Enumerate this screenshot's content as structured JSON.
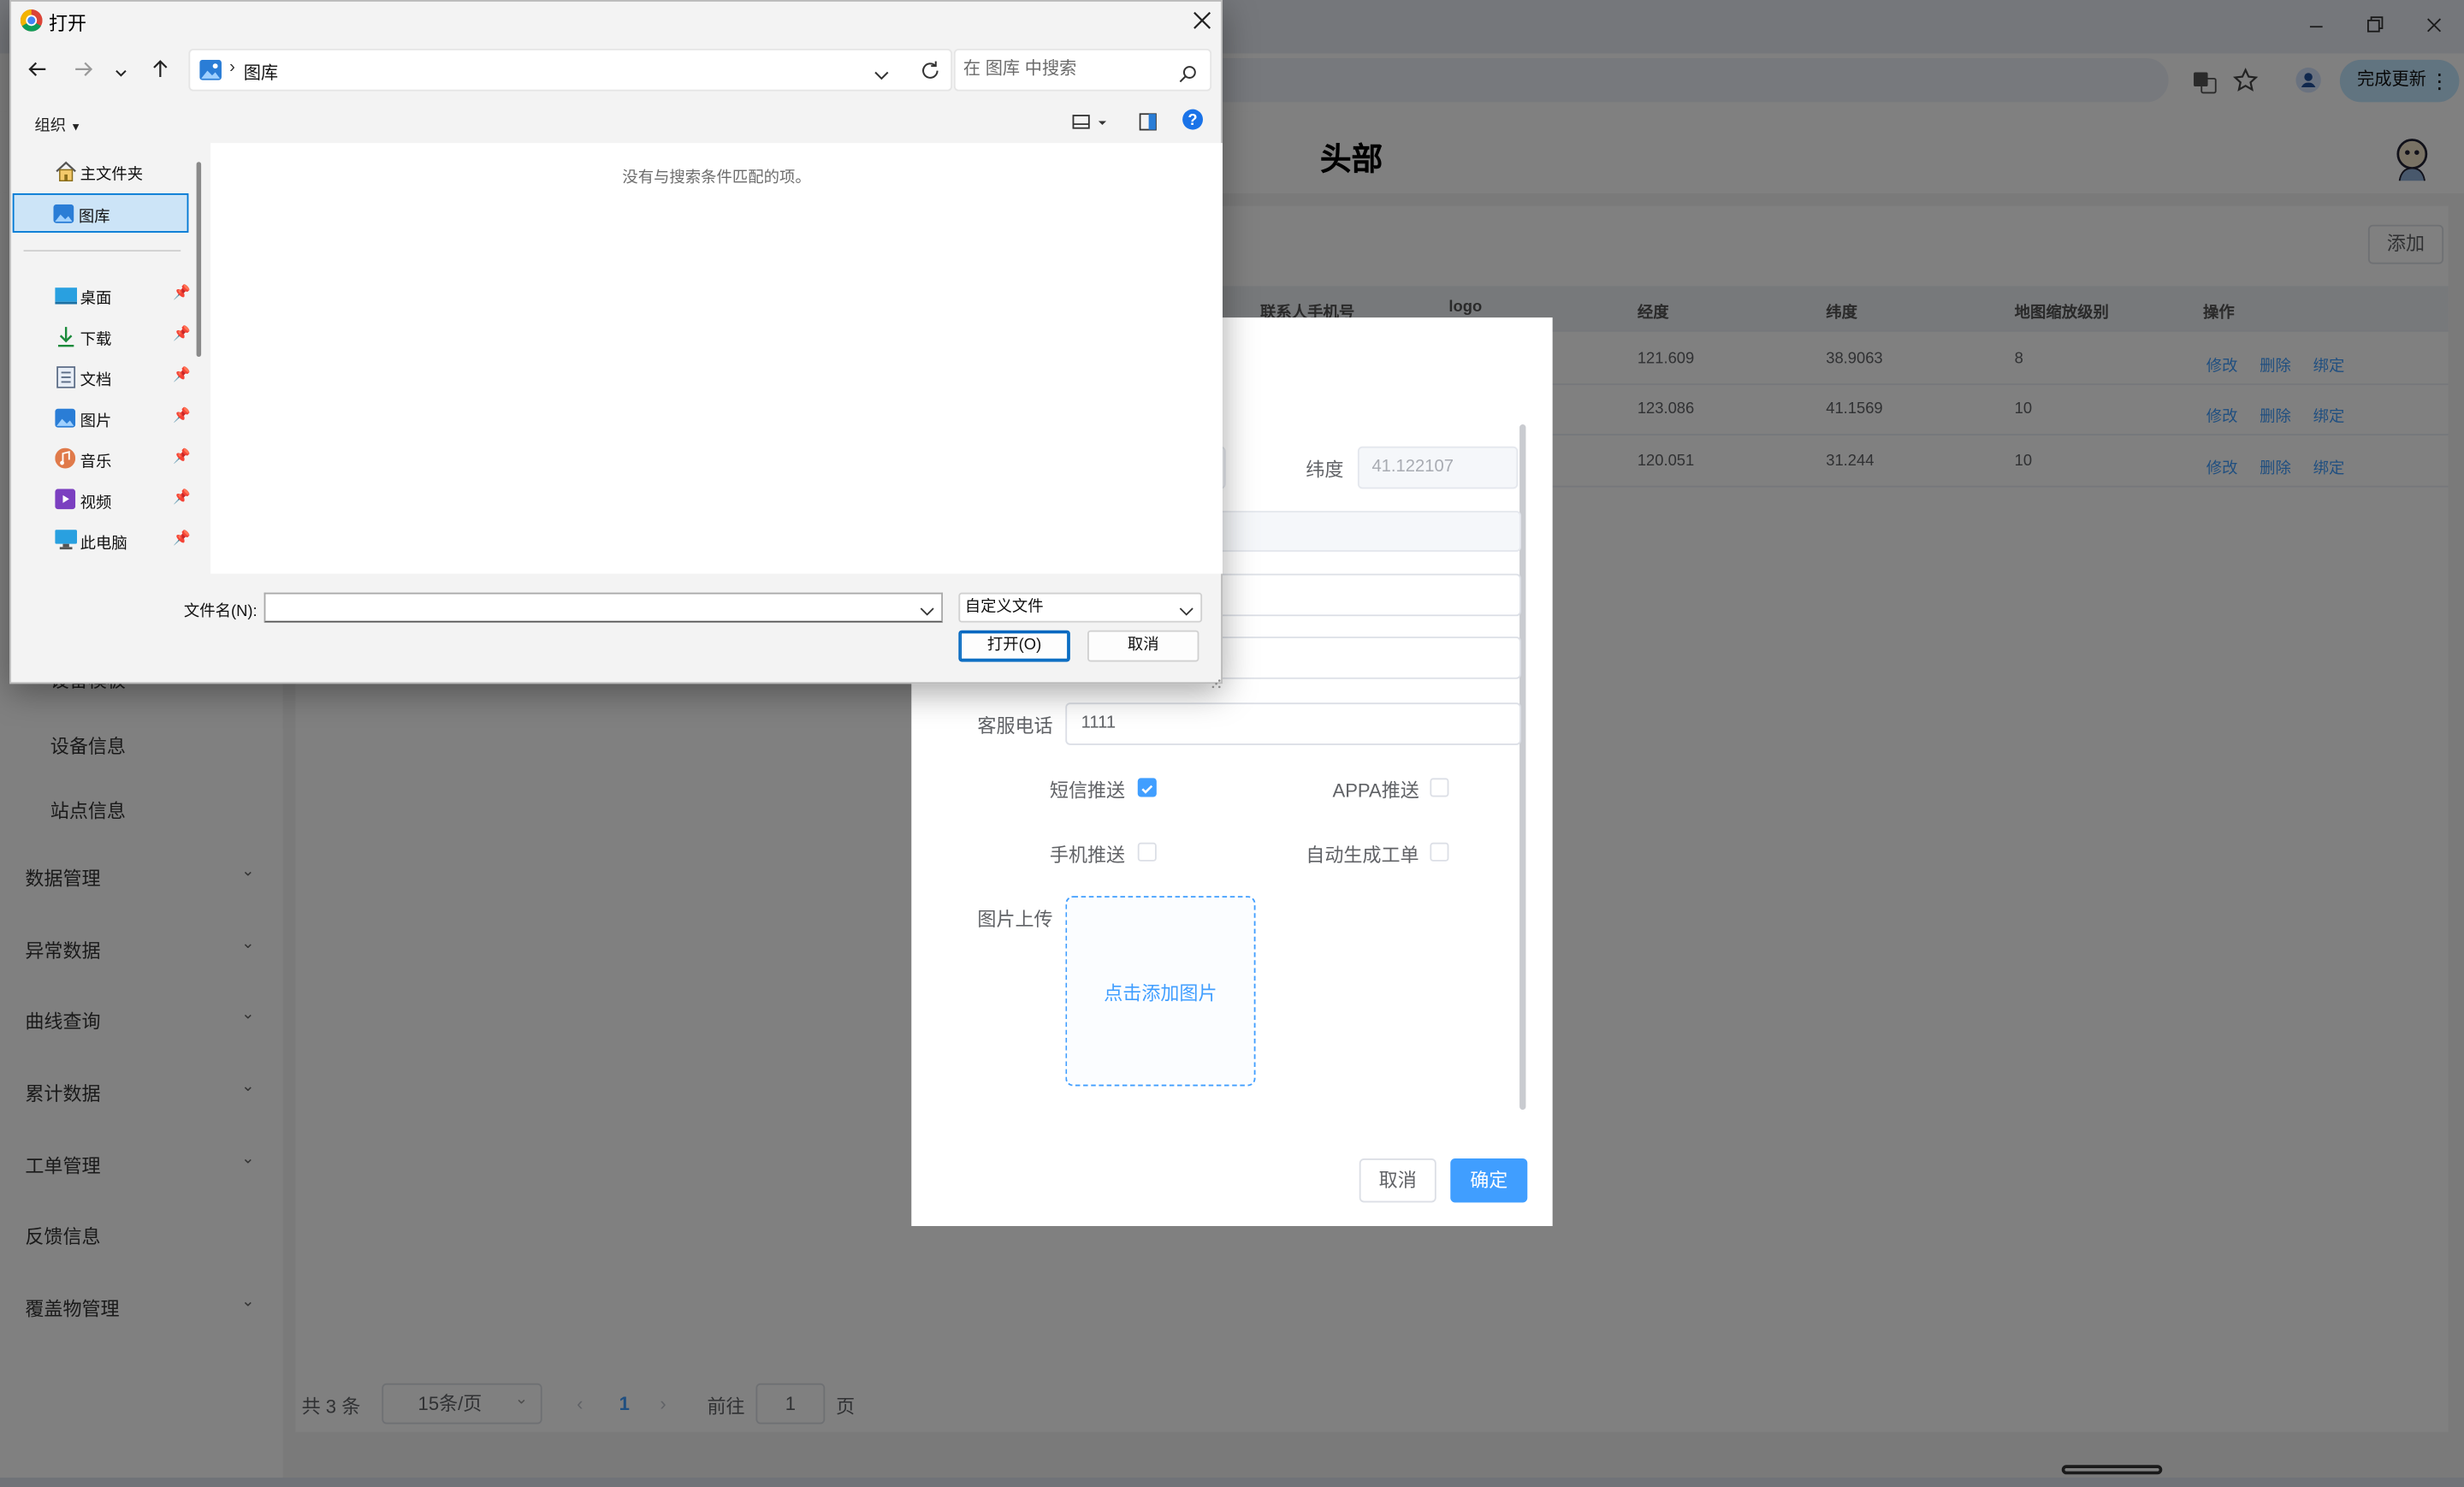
{
  "browser": {
    "update_label": "完成更新"
  },
  "app": {
    "header_title": "头部",
    "add_button": "添加",
    "table": {
      "headers": [
        "联系人手机号",
        "logo",
        "经度",
        "纬度",
        "地图缩放级别",
        "操作"
      ],
      "rows": [
        {
          "lng": "121.609",
          "lat": "38.9063",
          "zoom": "8"
        },
        {
          "lng": "123.086",
          "lat": "41.1569",
          "zoom": "10"
        },
        {
          "lng": "120.051",
          "lat": "31.244",
          "zoom": "10"
        }
      ],
      "actions": [
        "修改",
        "删除",
        "绑定"
      ]
    },
    "sidebar": {
      "items": [
        {
          "label": "设备模板",
          "type": "sub"
        },
        {
          "label": "设备信息",
          "type": "sub"
        },
        {
          "label": "站点信息",
          "type": "sub"
        },
        {
          "label": "数据管理",
          "type": "menu",
          "arrow": true
        },
        {
          "label": "异常数据",
          "type": "menu",
          "arrow": true
        },
        {
          "label": "曲线查询",
          "type": "menu",
          "arrow": true
        },
        {
          "label": "累计数据",
          "type": "menu",
          "arrow": true
        },
        {
          "label": "工单管理",
          "type": "menu",
          "arrow": true
        },
        {
          "label": "反馈信息",
          "type": "menu",
          "arrow": false
        },
        {
          "label": "覆盖物管理",
          "type": "menu",
          "arrow": true
        }
      ]
    },
    "pagination": {
      "total": "共 3 条",
      "page_size": "15条/页",
      "current_page": "1",
      "goto_label": "前往",
      "goto_value": "1",
      "page_unit": "页"
    }
  },
  "form_dialog": {
    "lat_label": "纬度",
    "lat_value": "41.122107",
    "phone_label": "客服电话",
    "phone_value": "1111",
    "sms_label": "短信推送",
    "sms_checked": true,
    "appa_label": "APPA推送",
    "appa_checked": false,
    "mobile_label": "手机推送",
    "mobile_checked": false,
    "auto_ticket_label": "自动生成工单",
    "auto_ticket_checked": false,
    "upload_label": "图片上传",
    "upload_prompt": "点击添加图片",
    "cancel": "取消",
    "confirm": "确定"
  },
  "file_dialog": {
    "title": "打开",
    "path_current": "图库",
    "search_placeholder": "在 图库 中搜索",
    "organize": "组织",
    "empty_message": "没有与搜索条件匹配的项。",
    "nav": [
      {
        "label": "主文件夹",
        "icon": "home-icon",
        "pinned": false,
        "selected": false
      },
      {
        "label": "图库",
        "icon": "gallery-icon",
        "pinned": false,
        "selected": true
      },
      {
        "label": "桌面",
        "icon": "desktop-icon",
        "pinned": true,
        "selected": false
      },
      {
        "label": "下载",
        "icon": "download-icon",
        "pinned": true,
        "selected": false
      },
      {
        "label": "文档",
        "icon": "document-icon",
        "pinned": true,
        "selected": false
      },
      {
        "label": "图片",
        "icon": "pictures-icon",
        "pinned": true,
        "selected": false
      },
      {
        "label": "音乐",
        "icon": "music-icon",
        "pinned": true,
        "selected": false
      },
      {
        "label": "视频",
        "icon": "video-icon",
        "pinned": true,
        "selected": false
      },
      {
        "label": "此电脑",
        "icon": "computer-icon",
        "pinned": true,
        "selected": false
      }
    ],
    "filename_label": "文件名(N):",
    "filename_value": "",
    "filetype": "自定义文件",
    "open_button": "打开(O)",
    "cancel_button": "取消"
  },
  "colors": {
    "accent": "#409eff",
    "dialog_bg": "#f3f3f3",
    "selection": "#cce4f7"
  }
}
